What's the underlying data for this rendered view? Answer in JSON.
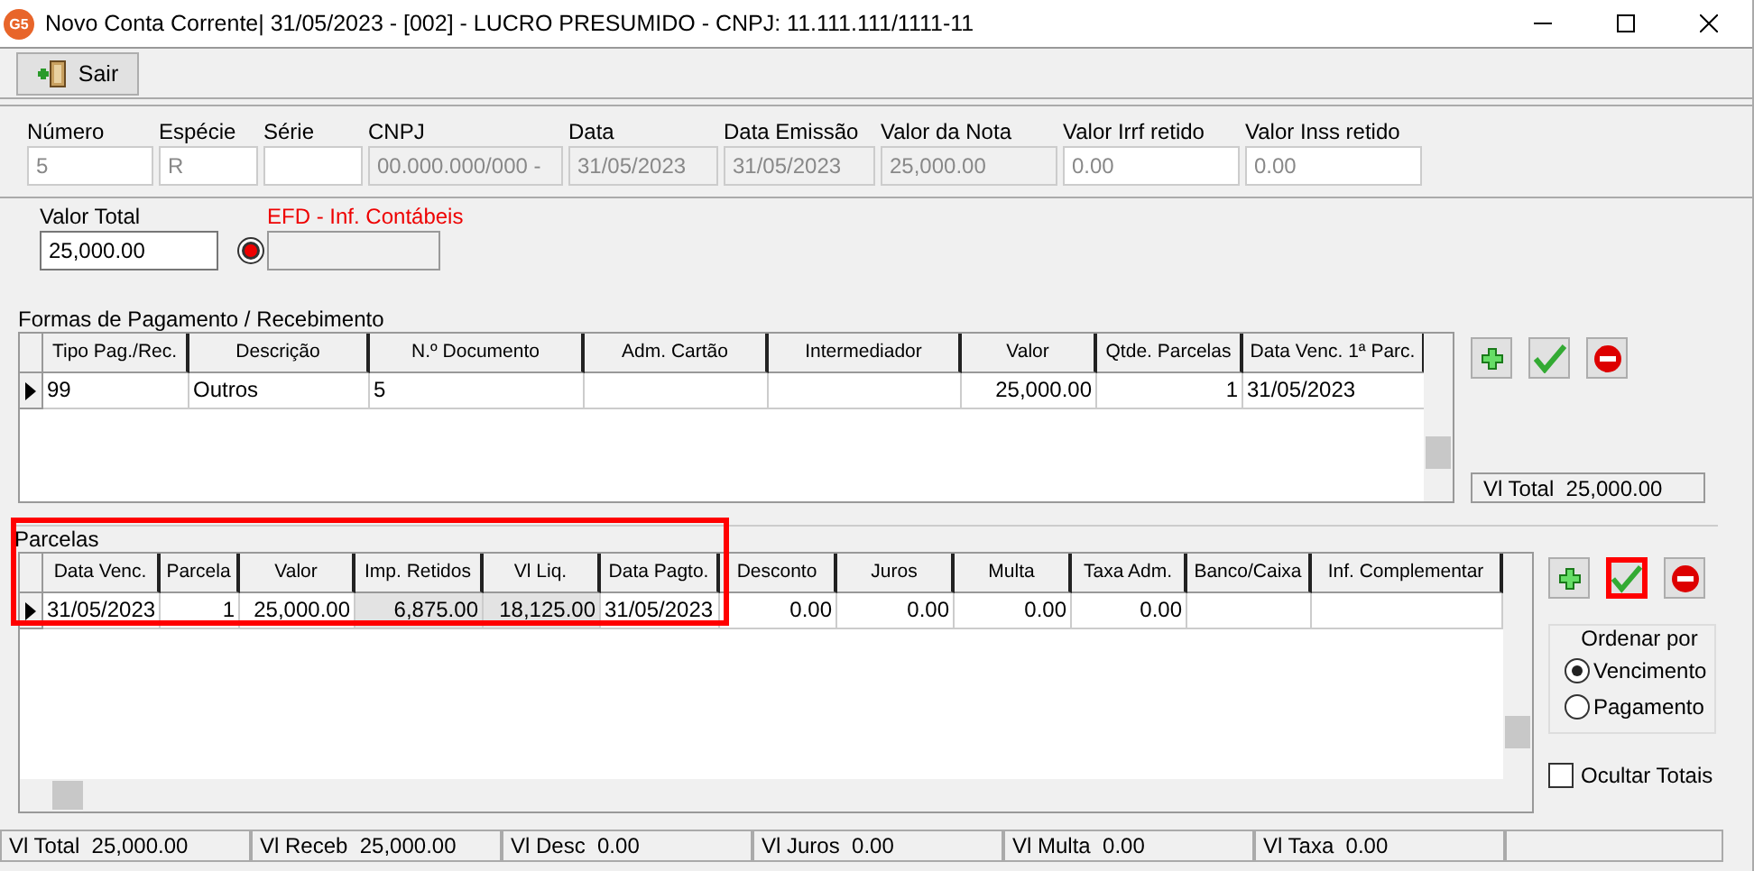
{
  "window": {
    "logo": "G5",
    "title": "Novo Conta Corrente|  31/05/2023 - [002] - LUCRO PRESUMIDO - CNPJ: 11.111.111/1111-11"
  },
  "toolbar": {
    "buttons": [
      {
        "label": "Sair"
      }
    ]
  },
  "header_fields": [
    {
      "label": "Número",
      "value": "5",
      "disabled": false
    },
    {
      "label": "Espécie",
      "value": "R",
      "disabled": false
    },
    {
      "label": "Série",
      "disabled": false
    },
    {
      "label": "CNPJ",
      "value": "00.000.000/000 -",
      "disabled": true
    },
    {
      "label": "Data",
      "value": "31/05/2023",
      "disabled": true
    },
    {
      "label": "Data Emissão",
      "value": "31/05/2023",
      "disabled": true
    },
    {
      "label": "Valor da Nota",
      "value": "25,000.00",
      "disabled": true
    },
    {
      "label": "Valor Irrf retido",
      "value": "0.00",
      "disabled": false
    },
    {
      "label": "Valor Inss retido",
      "value": "0.00",
      "disabled": false
    }
  ],
  "valor_total": {
    "label": "Valor Total",
    "value": "25,000.00"
  },
  "efd": {
    "label": "EFD - Inf. Contábeis"
  },
  "pagamentos": {
    "title": "Formas de Pagamento / Recebimento",
    "columns": [
      {
        "label": "Tipo Pag./Rec.",
        "readonly": false
      },
      {
        "label": "Descrição",
        "readonly": false
      },
      {
        "label": "N.º Documento",
        "readonly": false
      },
      {
        "label": "Adm. Cartão",
        "readonly": false
      },
      {
        "label": "Intermediador",
        "readonly": false
      },
      {
        "label": "Valor",
        "readonly": false
      },
      {
        "label": "Qtde. Parcelas",
        "readonly": false
      },
      {
        "label": "Data Venc. 1ª Parc.",
        "readonly": false
      }
    ],
    "rows": [
      {
        "current": true,
        "cells": [
          "99",
          "Outros",
          "5",
          "",
          "",
          "25,000.00",
          "1",
          "31/05/2023"
        ]
      }
    ],
    "buttons": [
      {
        "kind": "add",
        "highlighted": false
      },
      {
        "kind": "confirm",
        "highlighted": false
      },
      {
        "kind": "remove",
        "highlighted": false
      }
    ],
    "total": {
      "label": "Vl Total",
      "value": "25,000.00"
    }
  },
  "parcelas": {
    "title": "Parcelas",
    "highlighted": true,
    "columns": [
      {
        "label": "Data Venc.",
        "readonly": false
      },
      {
        "label": "Parcela",
        "readonly": false
      },
      {
        "label": "Valor",
        "readonly": false
      },
      {
        "label": "Imp. Retidos",
        "readonly": true
      },
      {
        "label": "Vl Liq.",
        "readonly": true
      },
      {
        "label": "Data Pagto.",
        "readonly": false
      },
      {
        "label": "Desconto",
        "readonly": false
      },
      {
        "label": "Juros",
        "readonly": false
      },
      {
        "label": "Multa",
        "readonly": false
      },
      {
        "label": "Taxa Adm.",
        "readonly": false
      },
      {
        "label": "Banco/Caixa",
        "readonly": false
      },
      {
        "label": "Inf. Complementar",
        "readonly": false
      }
    ],
    "rows": [
      {
        "current": true,
        "cells": [
          "31/05/2023",
          "1",
          "25,000.00",
          "6,875.00",
          "18,125.00",
          "31/05/2023",
          "0.00",
          "0.00",
          "0.00",
          "0.00",
          "",
          ""
        ]
      }
    ],
    "buttons": [
      {
        "kind": "add",
        "highlighted": false
      },
      {
        "kind": "confirm",
        "highlighted": true
      },
      {
        "kind": "remove",
        "highlighted": false
      }
    ],
    "ordenar": {
      "title": "Ordenar por",
      "options": [
        {
          "label": "Vencimento",
          "selected": true
        },
        {
          "label": "Pagamento",
          "selected": false
        }
      ]
    },
    "ocultar_totais": {
      "label": "Ocultar Totais",
      "checked": false
    }
  },
  "status_bar": [
    {
      "label": "Vl Total",
      "value": "25,000.00"
    },
    {
      "label": "Vl Receb",
      "value": "25,000.00"
    },
    {
      "label": "Vl Desc",
      "value": "0.00"
    },
    {
      "label": "Vl Juros",
      "value": "0.00"
    },
    {
      "label": "Vl Multa",
      "value": "0.00"
    },
    {
      "label": "Vl Taxa",
      "value": "0.00"
    }
  ]
}
